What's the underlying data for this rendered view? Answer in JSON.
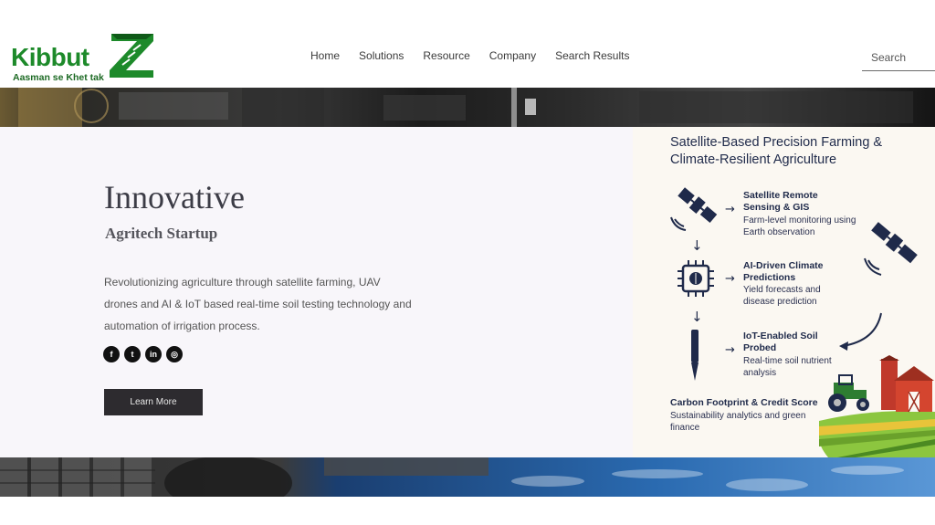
{
  "brand": {
    "name": "Kibbut",
    "tagline": "Aasman se Khet tak",
    "accent_color": "#1d8a2a"
  },
  "nav": {
    "items": [
      {
        "label": "Home"
      },
      {
        "label": "Solutions"
      },
      {
        "label": "Resource"
      },
      {
        "label": "Company"
      },
      {
        "label": "Search Results"
      }
    ]
  },
  "search": {
    "placeholder": "Search",
    "value": ""
  },
  "hero": {
    "title": "Innovative",
    "subtitle": "Agritech Startup",
    "text": "Revolutionizing agriculture through satellite farming, UAV drones and AI & IoT based real-time soil testing technology and automation of irrigation process.",
    "button_label": "Learn More",
    "socials": [
      {
        "icon": "facebook-icon",
        "glyph": "f"
      },
      {
        "icon": "twitter-icon",
        "glyph": "t"
      },
      {
        "icon": "linkedin-icon",
        "glyph": "in"
      },
      {
        "icon": "instagram-icon",
        "glyph": "◎"
      }
    ]
  },
  "infographic": {
    "title": "Satellite-Based Precision Farming & Climate-Resilient Agriculture",
    "steps": [
      {
        "title": "Satellite Remote Sensing & GIS",
        "desc": "Farm-level monitoring using Earth observation"
      },
      {
        "title": "AI-Driven Climate Predictions",
        "desc": "Yield forecasts and disease prediction"
      },
      {
        "title": "IoT-Enabled Soil Probed",
        "desc": "Real-time soil nutrient analysis"
      }
    ],
    "carbon": {
      "title": "Carbon Footprint & Credit Score",
      "desc": "Sustainability analytics and green finance"
    },
    "arrow_right": "→",
    "arrow_down": "↓"
  }
}
